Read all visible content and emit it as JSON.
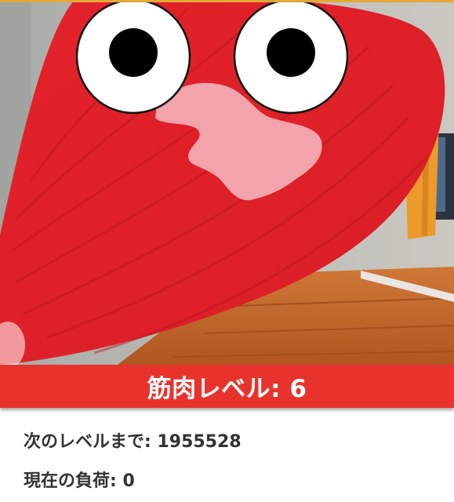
{
  "status": {
    "muscle_level_label": "筋肉レベル: ",
    "muscle_level": "6",
    "next_level_label": "次のレベルまで: ",
    "next_level_value": "1955528",
    "current_load_label": "現在の負荷: ",
    "current_load_value": "0"
  },
  "colors": {
    "muscle_red": "#e3222a",
    "level_bar": "#e8332c",
    "mouth_pink": "#f2a3ab",
    "floor_wood": "#c0632b",
    "curtain_orange": "#ec9a2a",
    "text_dark": "#333333"
  },
  "icons": {
    "character": "red-muscle-character",
    "eyes": "googly-eyes"
  }
}
